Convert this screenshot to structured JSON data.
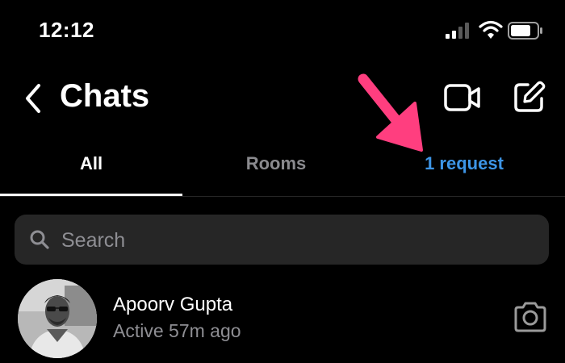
{
  "status_bar": {
    "time": "12:12",
    "icons": [
      "signal-icon",
      "wifi-icon",
      "battery-icon"
    ]
  },
  "header": {
    "title": "Chats",
    "icons": [
      "back-chevron-icon",
      "video-camera-icon",
      "compose-icon"
    ]
  },
  "tabs": [
    {
      "label": "All",
      "active": true
    },
    {
      "label": "Rooms",
      "active": false
    },
    {
      "label": "1 request",
      "active": false
    }
  ],
  "search": {
    "placeholder": "Search",
    "value": ""
  },
  "chats": [
    {
      "name": "Apoorv Gupta",
      "status": "Active 57m ago",
      "action_icon": "camera-icon"
    }
  ],
  "colors": {
    "background": "#000000",
    "accent_link": "#3d95e6",
    "muted_text": "#8e8e93",
    "search_background": "#262626",
    "annotation_arrow": "#ff3e7f"
  }
}
